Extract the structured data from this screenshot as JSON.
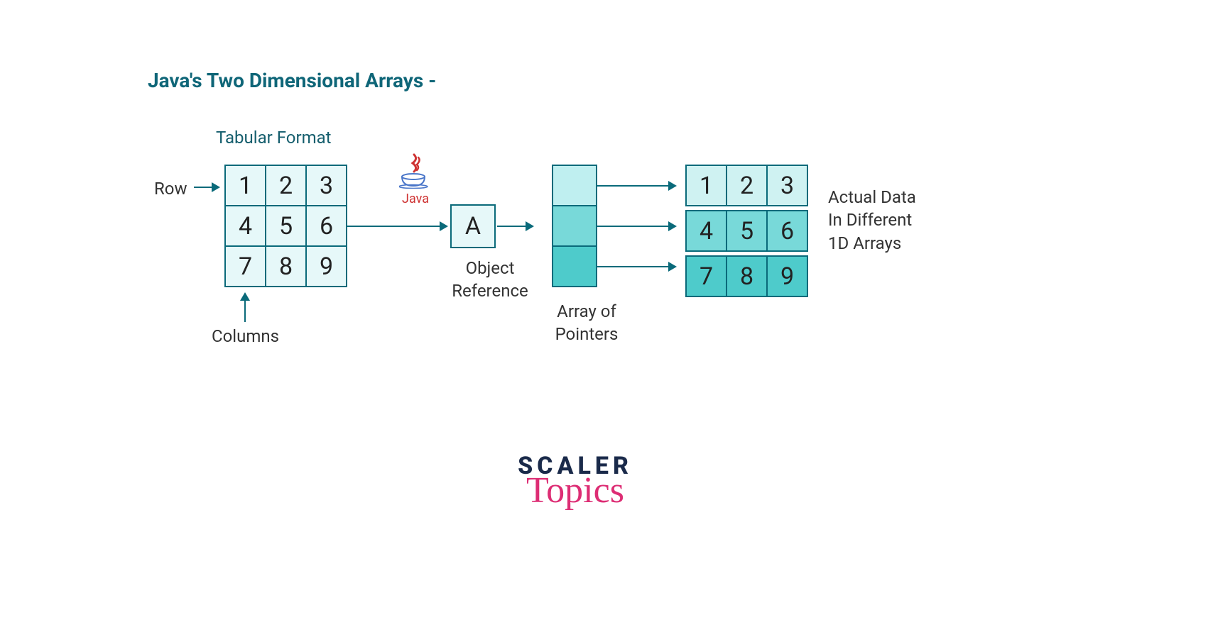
{
  "title": "Java's Two Dimensional Arrays -",
  "labels": {
    "tabular": "Tabular Format",
    "row": "Row",
    "columns": "Columns",
    "object_ref_1": "Object",
    "object_ref_2": "Reference",
    "pointers_1": "Array of",
    "pointers_2": "Pointers",
    "actual_1": "Actual Data",
    "actual_2": "In Different",
    "actual_3": "1D Arrays"
  },
  "grid": {
    "rows": [
      [
        "1",
        "2",
        "3"
      ],
      [
        "4",
        "5",
        "6"
      ],
      [
        "7",
        "8",
        "9"
      ]
    ]
  },
  "object_ref_value": "A",
  "data_arrays": [
    [
      "1",
      "2",
      "3"
    ],
    [
      "4",
      "5",
      "6"
    ],
    [
      "7",
      "8",
      "9"
    ]
  ],
  "java_logo_text": "Java",
  "scaler": {
    "top": "SCALER",
    "bottom": "Topics"
  },
  "colors": {
    "cell_bg_light": "#e6f8f9",
    "pointer_0": "#bfeff0",
    "pointer_1": "#78d9d9",
    "pointer_2": "#4ecbcb",
    "row1_bg": "#cff2f2",
    "row2_bg": "#78d9d9",
    "row3_bg": "#4ecbcb",
    "title_color": "#0f6678",
    "border": "#0a6a7a"
  }
}
